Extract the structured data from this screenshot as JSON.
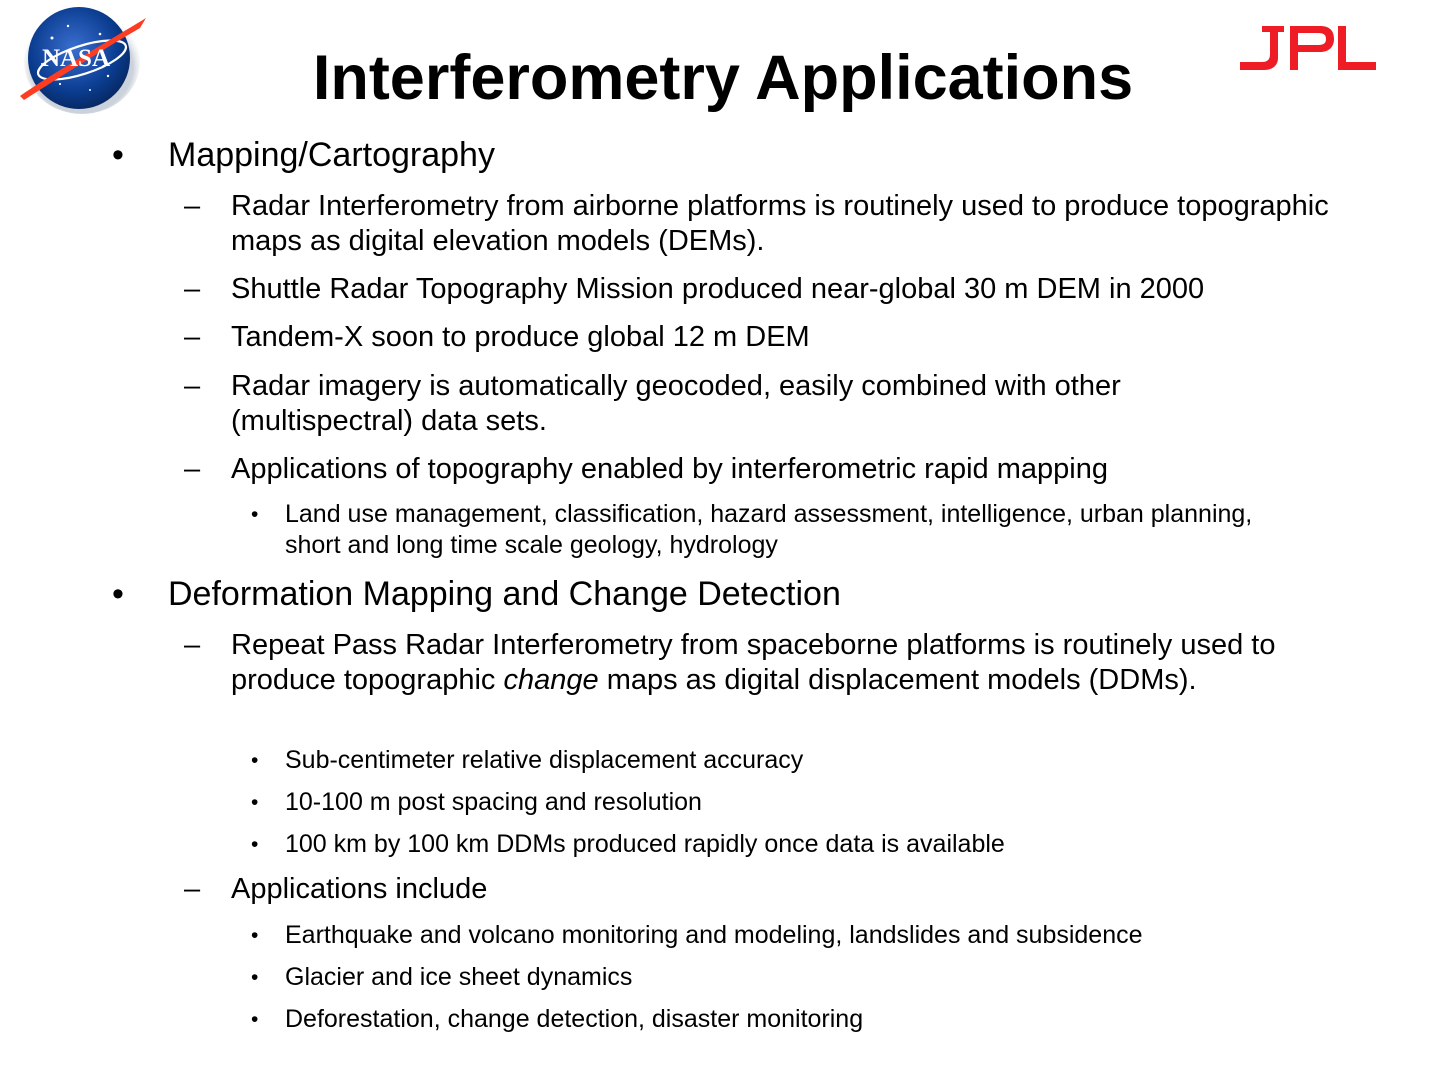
{
  "slide": {
    "title": "Interferometry Applications"
  },
  "logos": {
    "nasa": "NASA",
    "jpl": "JPL",
    "jpl_color": "#ee1c24",
    "nasa_blue": "#0b3d91",
    "nasa_red": "#fc3d21"
  },
  "bullets": {
    "mapping": {
      "label": "Mapping/Cartography",
      "items": [
        "Radar Interferometry from airborne platforms is routinely used to produce topographic maps as digital elevation models (DEMs).",
        "Shuttle Radar Topography Mission produced near-global 30 m DEM in 2000",
        "Tandem-X soon to produce global 12 m DEM",
        "Radar imagery is automatically geocoded, easily combined with other (multispectral) data sets.",
        "Applications of topography enabled by interferometric rapid mapping"
      ],
      "applications_sub": [
        "Land use management, classification, hazard assessment, intelligence, urban planning, short and long time scale geology, hydrology"
      ]
    },
    "deformation": {
      "label": "Deformation Mapping and Change Detection",
      "repeat_pass_before": "Repeat Pass Radar Interferometry from spaceborne platforms is routinely used to produce topographic ",
      "repeat_pass_italic": "change",
      "repeat_pass_after": " maps as digital displacement models (DDMs).",
      "repeat_pass_sub": [
        "Sub-centimeter relative displacement accuracy",
        "10-100 m post spacing and resolution",
        "100 km by 100 km DDMs produced rapidly once data is available"
      ],
      "applications_label": "Applications include",
      "applications_sub": [
        "Earthquake and volcano monitoring and modeling, landslides and subsidence",
        "Glacier and ice sheet dynamics",
        "Deforestation, change detection, disaster monitoring"
      ]
    }
  },
  "markers": {
    "level1": "•",
    "level2": "–",
    "level3": "•"
  }
}
